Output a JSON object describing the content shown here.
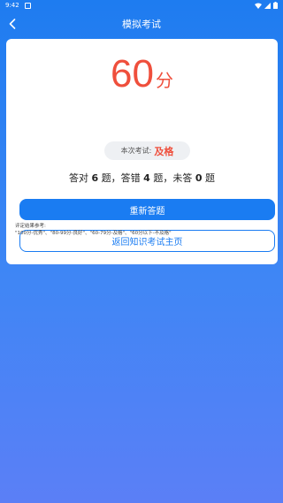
{
  "status_bar": {
    "time": "9:42"
  },
  "header": {
    "title": "模拟考试"
  },
  "result": {
    "score": "60",
    "score_unit": "分",
    "exam_label": "本次考试:",
    "exam_result": "及格",
    "stats": {
      "prefix_correct": "答对 ",
      "correct": "6",
      "suffix_correct": " 题，答错 ",
      "wrong": "4",
      "suffix_wrong": " 题，未答 ",
      "unanswered": "0",
      "suffix_unanswered": " 题"
    }
  },
  "buttons": {
    "retry": "重新答题",
    "home": "返回知识考试主页"
  },
  "criteria": {
    "title": "评定结果参考:",
    "text": "\"100分-优秀\"、\"80-99分-良好\"、\"60-79分-及格\"、\"60分以下-不及格\""
  },
  "colors": {
    "primary": "#1a7cf2",
    "score": "#ef4f3c"
  }
}
